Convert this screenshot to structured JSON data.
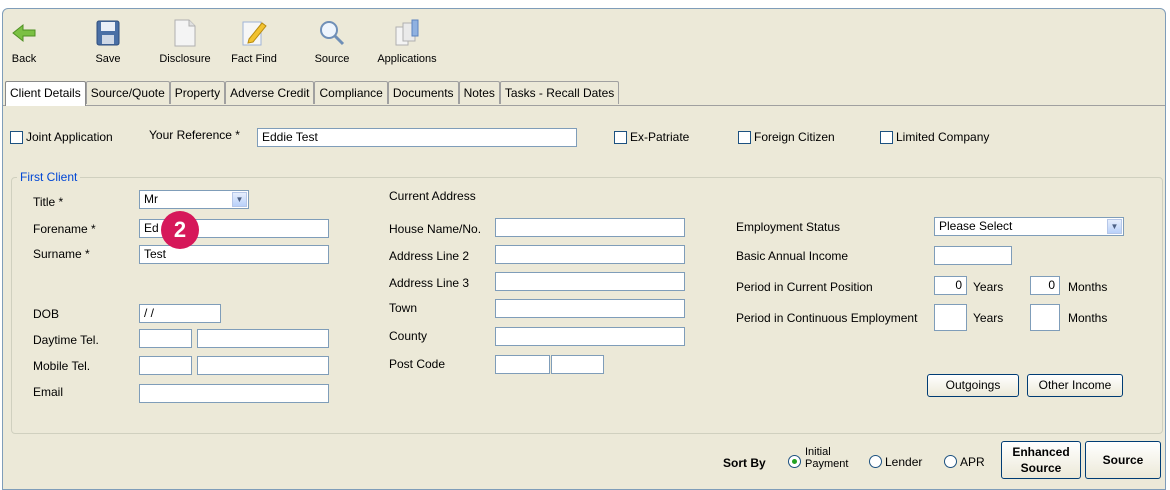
{
  "toolbar": {
    "back": "Back",
    "save": "Save",
    "disclosure": "Disclosure",
    "fact_find": "Fact Find",
    "source": "Source",
    "applications": "Applications"
  },
  "tabs": [
    "Client Details",
    "Source/Quote",
    "Property",
    "Adverse Credit",
    "Compliance",
    "Documents",
    "Notes",
    "Tasks - Recall Dates"
  ],
  "top_row": {
    "joint_application": "Joint Application",
    "your_reference_label": "Your Reference *",
    "your_reference_value": "Eddie Test",
    "ex_patriate": "Ex-Patriate",
    "foreign_citizen": "Foreign Citizen",
    "limited_company": "Limited Company"
  },
  "first_client": {
    "group_title": "First Client",
    "title_label": "Title *",
    "title_value": "Mr",
    "forename_label": "Forename *",
    "forename_value": "Ed",
    "surname_label": "Surname *",
    "surname_value": "Test",
    "dob_label": "DOB",
    "dob_value": " / /",
    "daytime_tel_label": "Daytime Tel.",
    "mobile_tel_label": "Mobile Tel.",
    "email_label": "Email"
  },
  "address": {
    "heading": "Current Address",
    "house_label": "House Name/No.",
    "line2_label": "Address Line 2",
    "line3_label": "Address Line 3",
    "town_label": "Town",
    "county_label": "County",
    "postcode_label": "Post Code"
  },
  "employment": {
    "status_label": "Employment Status",
    "status_value": "Please Select",
    "income_label": "Basic Annual Income",
    "current_position_label": "Period in Current Position",
    "current_years_value": "0",
    "current_months_value": "0",
    "years_label": "Years",
    "months_label": "Months",
    "continuous_label": "Period in Continuous Employment",
    "outgoings_button": "Outgoings",
    "other_income_button": "Other Income"
  },
  "badge": "2",
  "sort": {
    "label": "Sort By",
    "initial_payment_line1": "Initial",
    "initial_payment_line2": "Payment",
    "lender": "Lender",
    "apr": "APR",
    "enhanced_line1": "Enhanced",
    "enhanced_line2": "Source",
    "source_button": "Source"
  },
  "colors": {
    "accent_badge": "#d6185a",
    "group_title": "#0046d5",
    "window_bg": "#ece9d8"
  }
}
